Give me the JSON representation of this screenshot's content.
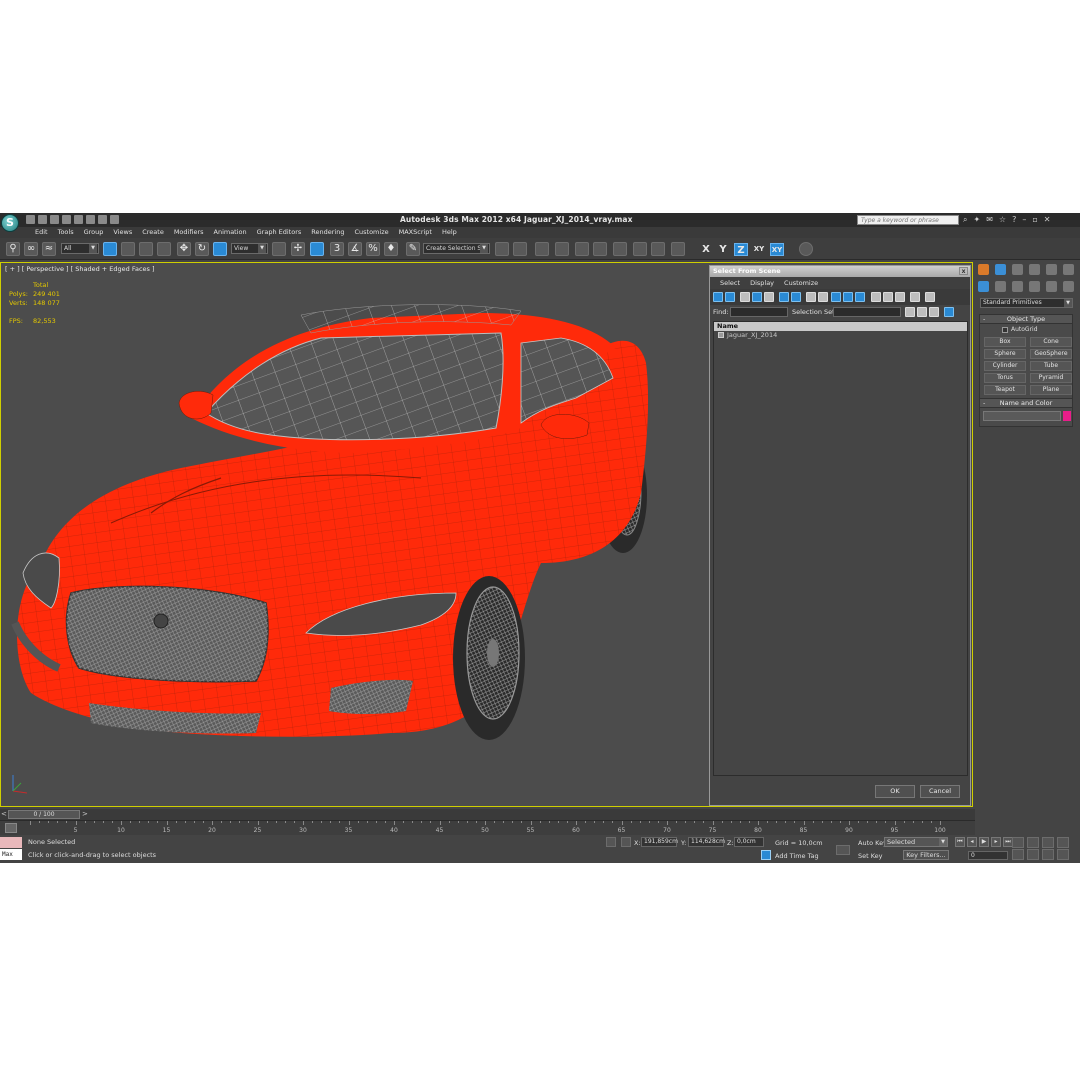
{
  "window": {
    "title": "Autodesk 3ds Max  2012 x64      Jaguar_XJ_2014_vray.max",
    "search_placeholder": "Type a keyword or phrase"
  },
  "menu": [
    "Edit",
    "Tools",
    "Group",
    "Views",
    "Create",
    "Modifiers",
    "Animation",
    "Graph Editors",
    "Rendering",
    "Customize",
    "MAXScript",
    "Help"
  ],
  "toolbar": {
    "filter_value": "All",
    "ref_coord_value": "View",
    "named_selection_value": "Create Selection Se",
    "snap_label": "3",
    "axes": [
      "X",
      "Y",
      "Z",
      "XY",
      "XY"
    ]
  },
  "viewport": {
    "label": "[ + ] [ Perspective ] [ Shaded + Edged Faces ]",
    "stats": {
      "header": "Total",
      "polys_label": "Polys:",
      "polys_value": "249 401",
      "verts_label": "Verts:",
      "verts_value": "148 077",
      "fps_label": "FPS:",
      "fps_value": "82,553"
    },
    "object_color": "#ff2a0a"
  },
  "dialog": {
    "title": "Select From Scene",
    "close_glyph": "x",
    "menu": [
      "Select",
      "Display",
      "Customize"
    ],
    "find_label": "Find:",
    "selection_set_label": "Selection Set:",
    "column_header": "Name",
    "items": [
      "Jaguar_XJ_2014"
    ],
    "ok_label": "OK",
    "cancel_label": "Cancel"
  },
  "command_panel": {
    "category_value": "Standard Primitives",
    "object_type_title": "Object Type",
    "autogrid_label": "AutoGrid",
    "primitives": [
      "Box",
      "Cone",
      "Sphere",
      "GeoSphere",
      "Cylinder",
      "Tube",
      "Torus",
      "Pyramid",
      "Teapot",
      "Plane"
    ],
    "name_color_title": "Name and Color",
    "swatch_color": "#e81e8a"
  },
  "timeline": {
    "slider_label": "0 / 100",
    "prev_glyph": "<",
    "next_glyph": ">",
    "ticks": [
      "5",
      "10",
      "15",
      "20",
      "25",
      "30",
      "35",
      "40",
      "45",
      "50",
      "55",
      "60",
      "65",
      "70",
      "75",
      "80",
      "85",
      "90",
      "95",
      "100"
    ]
  },
  "status": {
    "selection": "None Selected",
    "prompt": "Click or click-and-drag to select objects",
    "maxscript_label": "Max",
    "x_label": "X:",
    "x_value": "191,859cm",
    "y_label": "Y:",
    "y_value": "114,628cm",
    "z_label": "Z:",
    "z_value": "0,0cm",
    "grid": "Grid = 10,0cm",
    "add_time_tag": "Add Time Tag",
    "auto_key": "Auto Key",
    "set_key": "Set Key",
    "key_mode_value": "Selected",
    "key_filters": "Key Filters...",
    "frame_value": "0"
  }
}
